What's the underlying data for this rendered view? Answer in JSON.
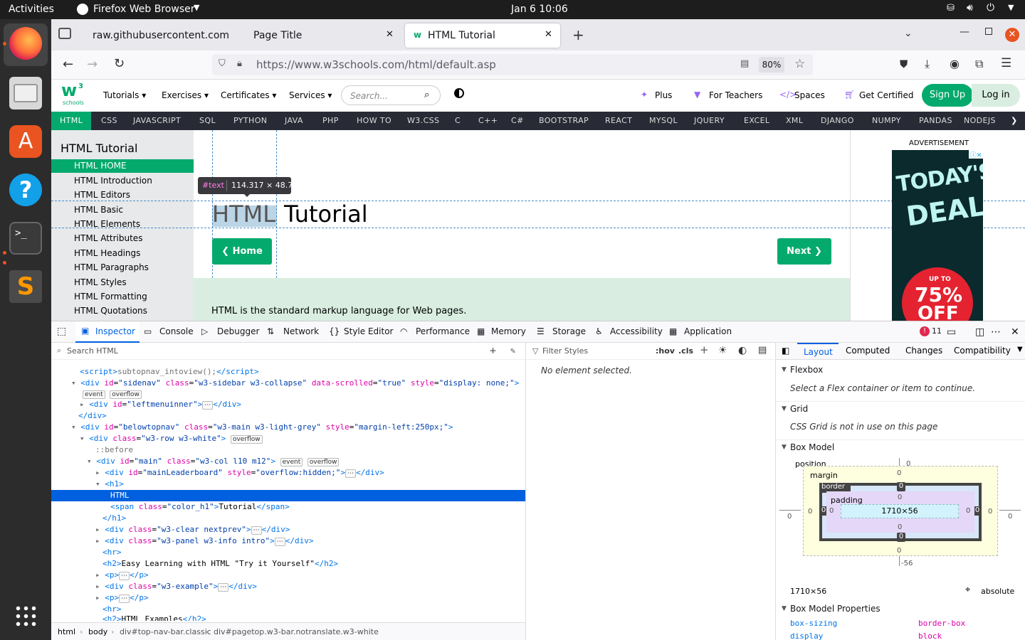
{
  "system_bar": {
    "activities": "Activities",
    "app": "Firefox Web Browser",
    "clock": "Jan 6  10:06"
  },
  "dock": {
    "items": [
      "firefox-icon",
      "files-icon",
      "app-center-icon",
      "help-icon",
      "terminal-icon",
      "sublime-text-icon"
    ],
    "apps_grid": "show-apps-icon"
  },
  "browser": {
    "tabs": [
      {
        "label": "raw.githubusercontent.com"
      },
      {
        "label": "Page Title"
      },
      {
        "label": "HTML Tutorial",
        "active": true
      }
    ],
    "url": "https://www.w3schools.com/html/default.asp",
    "url_host": "www.w3schools.com",
    "zoom": "80%"
  },
  "w3": {
    "logo_top": "w",
    "logo_sup": "3",
    "logo_bottom": "schools",
    "menu": [
      "Tutorials",
      "Exercises",
      "Certificates",
      "Services"
    ],
    "search_placeholder": "Search...",
    "right_links": [
      "Plus",
      "For Teachers",
      "Spaces",
      "Get Certified"
    ],
    "signup": "Sign Up",
    "login": "Log in",
    "topnav": [
      "HTML",
      "CSS",
      "JAVASCRIPT",
      "SQL",
      "PYTHON",
      "JAVA",
      "PHP",
      "HOW TO",
      "W3.CSS",
      "C",
      "C++",
      "C#",
      "BOOTSTRAP",
      "REACT",
      "MYSQL",
      "JQUERY",
      "EXCEL",
      "XML",
      "DJANGO",
      "NUMPY",
      "PANDAS",
      "NODEJS"
    ],
    "topnav_more": "❯",
    "sidenav_title": "HTML Tutorial",
    "sidenav_items": [
      "HTML HOME",
      "HTML Introduction",
      "HTML Editors",
      "HTML Basic",
      "HTML Elements",
      "HTML Attributes",
      "HTML Headings",
      "HTML Paragraphs",
      "HTML Styles",
      "HTML Formatting",
      "HTML Quotations"
    ],
    "h1_first": "HTML",
    "h1_second": "Tutorial",
    "btn_home": "❮ Home",
    "btn_next": "Next ❯",
    "intro": "HTML is the standard markup language for Web pages.",
    "ad_label": "ADVERTISEMENT",
    "ad_text1": "TODAY'S",
    "ad_text2": "DEAL",
    "ad_upto": "UP TO",
    "ad_pct": "75%",
    "ad_off": "OFF",
    "tooltip_type": "#text",
    "tooltip_size": "114.317 × 48.75"
  },
  "devtools": {
    "tabs": [
      "Inspector",
      "Console",
      "Debugger",
      "Network",
      "Style Editor",
      "Performance",
      "Memory",
      "Storage",
      "Accessibility",
      "Application"
    ],
    "error_count": "11",
    "search_html": "Search HTML",
    "filter_styles": "Filter Styles",
    "hov": ":hov",
    "cls": ".cls",
    "no_element": "No element selected.",
    "layout_tabs": [
      "Layout",
      "Computed",
      "Changes",
      "Compatibility"
    ],
    "flexbox_title": "Flexbox",
    "flexbox_msg": "Select a Flex container or item to continue.",
    "grid_title": "Grid",
    "grid_msg": "CSS Grid is not in use on this page",
    "boxmodel_title": "Box Model",
    "bm": {
      "position": "position",
      "margin": "margin",
      "border": "border",
      "padding": "padding",
      "content": "1710×56",
      "zero": "0",
      "bottom_offset": "-56"
    },
    "bm_size": "1710×56",
    "bm_position": "absolute",
    "bmp_title": "Box Model Properties",
    "bmp": [
      {
        "name": "box-sizing",
        "value": "border-box"
      },
      {
        "name": "display",
        "value": "block"
      }
    ],
    "breadcrumbs": [
      "html",
      "body",
      "div#top-nav-bar.classic",
      "div#pagetop.w3-bar.notranslate.w3-white"
    ]
  }
}
